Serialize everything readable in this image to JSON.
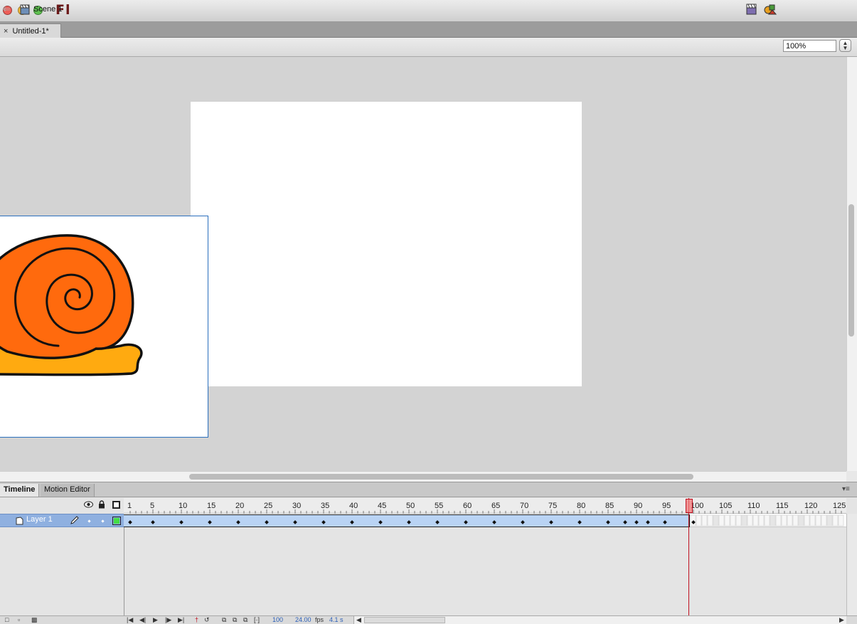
{
  "app": {
    "logo": "Fl"
  },
  "document_tab": {
    "close": "×",
    "title": "Untitled-1*"
  },
  "editbar": {
    "scene_label": "Scene 1",
    "zoom": "100%"
  },
  "panel_tabs": {
    "timeline": "Timeline",
    "motion_editor": "Motion Editor"
  },
  "timeline": {
    "ruler_labels": [
      "1",
      "5",
      "10",
      "15",
      "20",
      "25",
      "30",
      "35",
      "40",
      "45",
      "50",
      "55",
      "60",
      "65",
      "70",
      "75",
      "80",
      "85",
      "90",
      "95",
      "100",
      "105",
      "110",
      "115",
      "120",
      "125"
    ],
    "layer_name": "Layer 1",
    "current_frame": "100",
    "frame_rate": "24.00",
    "fps_unit": "fps",
    "elapsed_time": "4.1 s",
    "keyframe_last": 100,
    "layer_color": "#44dd44"
  },
  "colors": {
    "shell_orange": "#ff6a0d",
    "foot_orange": "#ffaa10",
    "layer_highlight": "#8fb0e0",
    "playhead": "#c01020"
  }
}
